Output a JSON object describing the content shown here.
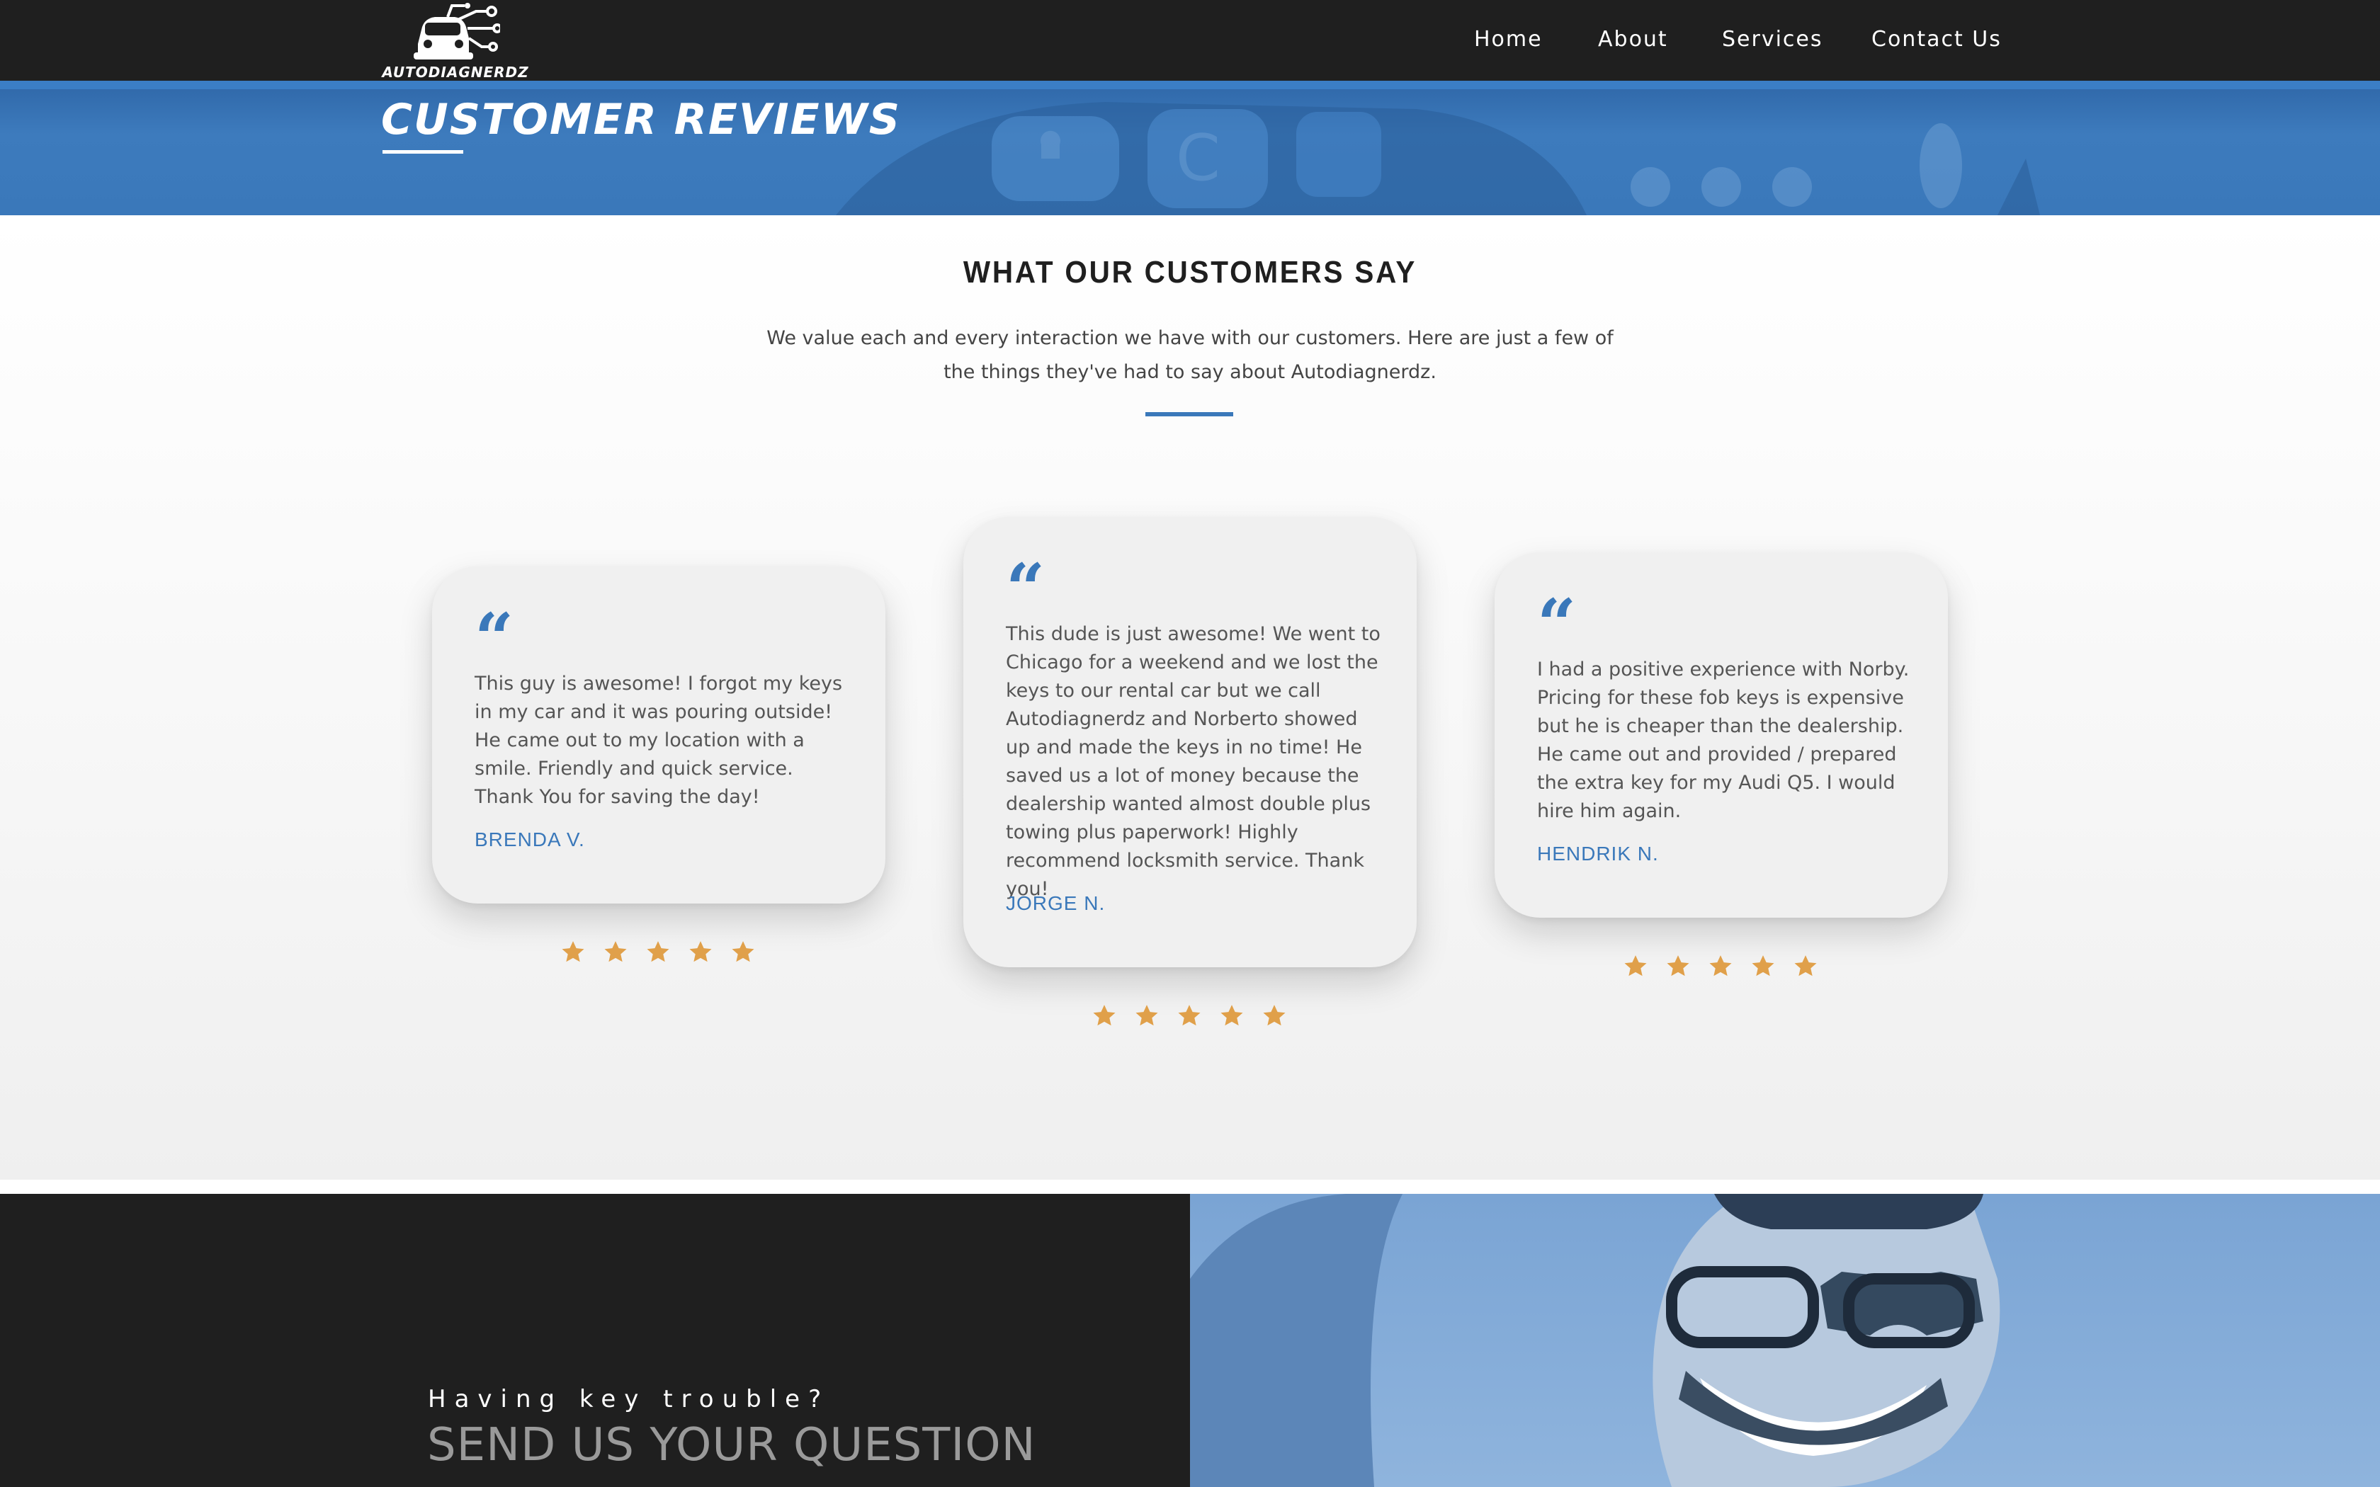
{
  "brand": {
    "logo_text": "AUTODIAGNERDZ"
  },
  "nav": {
    "items": [
      {
        "label": "Home"
      },
      {
        "label": "About"
      },
      {
        "label": "Services"
      },
      {
        "label": "Contact Us"
      }
    ]
  },
  "hero": {
    "title": "CUSTOMER REVIEWS"
  },
  "section": {
    "title": "WHAT OUR CUSTOMERS SAY",
    "description": "We value each and every interaction we have with our customers. Here are just a few of the things they've had to say about Autodiagnerdz."
  },
  "reviews": [
    {
      "quote_mark": "“",
      "text": "This guy is awesome! I forgot my keys in my car and it was pouring outside! He came out to my location with a smile. Friendly and quick service. Thank You for saving the day!",
      "author": "BRENDA V.",
      "rating": 5
    },
    {
      "quote_mark": "“",
      "text": "This dude is just awesome! We went to Chicago for a weekend and we lost the keys to our rental car but we call Autodiagnerdz and Norberto showed up and made the keys in no time! He saved us a lot of money because the dealership wanted almost double plus towing plus paperwork! Highly recommend locksmith service. Thank you!",
      "author": "JORGE N.",
      "rating": 5
    },
    {
      "quote_mark": "“",
      "text": "I had a positive experience with Norby. Pricing for these fob keys is expensive but he is cheaper than the dealership. He came out and provided / prepared the extra key for my Audi Q5. I would hire him again.",
      "author": "HENDRIK N.",
      "rating": 5
    }
  ],
  "cta": {
    "kicker": "Having key trouble?",
    "heading": "SEND US YOUR QUESTION"
  },
  "colors": {
    "accent": "#3a78ba",
    "nav_bg": "#1f1f1f",
    "star": "#e0a04a"
  }
}
